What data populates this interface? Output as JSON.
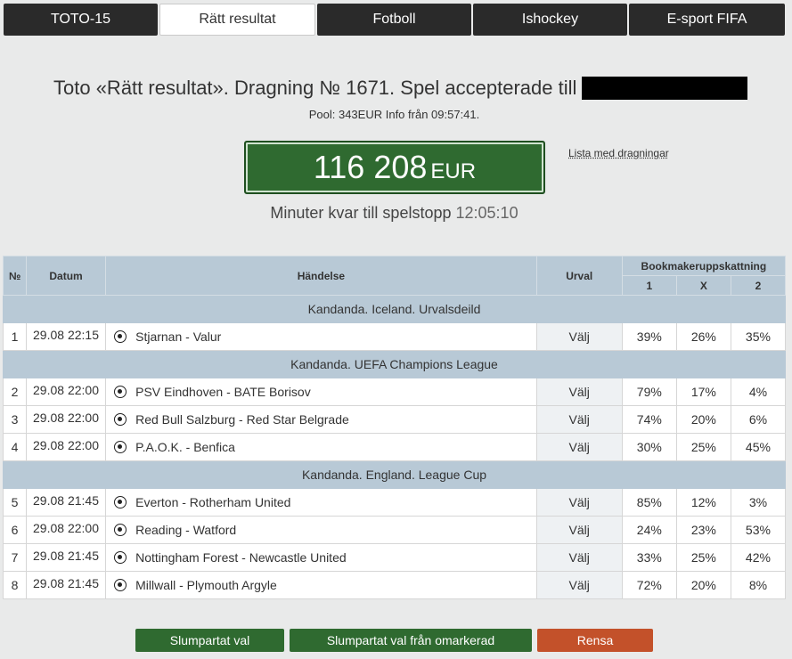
{
  "tabs": [
    {
      "label": "TOTO-15",
      "active": false
    },
    {
      "label": "Rätt resultat",
      "active": true
    },
    {
      "label": "Fotboll",
      "active": false
    },
    {
      "label": "Ishockey",
      "active": false
    },
    {
      "label": "E-sport FIFA",
      "active": false
    }
  ],
  "header": {
    "title": "Toto «Rätt resultat». Dragning № 1671. Spel accepterade till",
    "pool_info": "Pool: 343EUR Info från 09:57:41.",
    "jackpot_amount": "116 208",
    "jackpot_currency": "EUR",
    "draws_link": "Lista med dragningar",
    "countdown_label": "Minuter kvar till spelstopp",
    "countdown_time": "12:05:10"
  },
  "table": {
    "headers": {
      "num": "№",
      "date": "Datum",
      "event": "Händelse",
      "pick": "Urval",
      "bookmaker": "Bookmakeruppskattning",
      "col1": "1",
      "colx": "X",
      "col2": "2"
    },
    "groups": [
      {
        "title": "Kandanda. Iceland. Urvalsdeild",
        "rows": [
          {
            "num": "1",
            "date": "29.08 22:15",
            "event": "Stjarnan - Valur",
            "pick": "Välj",
            "p1": "39%",
            "px": "26%",
            "p2": "35%"
          }
        ]
      },
      {
        "title": "Kandanda. UEFA Champions League",
        "rows": [
          {
            "num": "2",
            "date": "29.08 22:00",
            "event": "PSV Eindhoven - BATE Borisov",
            "pick": "Välj",
            "p1": "79%",
            "px": "17%",
            "p2": "4%"
          },
          {
            "num": "3",
            "date": "29.08 22:00",
            "event": "Red Bull Salzburg - Red Star Belgrade",
            "pick": "Välj",
            "p1": "74%",
            "px": "20%",
            "p2": "6%"
          },
          {
            "num": "4",
            "date": "29.08 22:00",
            "event": "P.A.O.K. - Benfica",
            "pick": "Välj",
            "p1": "30%",
            "px": "25%",
            "p2": "45%"
          }
        ]
      },
      {
        "title": "Kandanda. England. League Cup",
        "rows": [
          {
            "num": "5",
            "date": "29.08 21:45",
            "event": "Everton - Rotherham United",
            "pick": "Välj",
            "p1": "85%",
            "px": "12%",
            "p2": "3%"
          },
          {
            "num": "6",
            "date": "29.08 22:00",
            "event": "Reading - Watford",
            "pick": "Välj",
            "p1": "24%",
            "px": "23%",
            "p2": "53%"
          },
          {
            "num": "7",
            "date": "29.08 21:45",
            "event": "Nottingham Forest - Newcastle United",
            "pick": "Välj",
            "p1": "33%",
            "px": "25%",
            "p2": "42%"
          },
          {
            "num": "8",
            "date": "29.08 21:45",
            "event": "Millwall - Plymouth Argyle",
            "pick": "Välj",
            "p1": "72%",
            "px": "20%",
            "p2": "8%"
          }
        ]
      }
    ]
  },
  "buttons": {
    "random": "Slumpartat val",
    "random_unmarked": "Slumpartat val från omarkerad",
    "clear": "Rensa"
  },
  "colors": {
    "green": "#2f6a30",
    "orange": "#c3512a",
    "header_blue": "#b8c9d6"
  }
}
